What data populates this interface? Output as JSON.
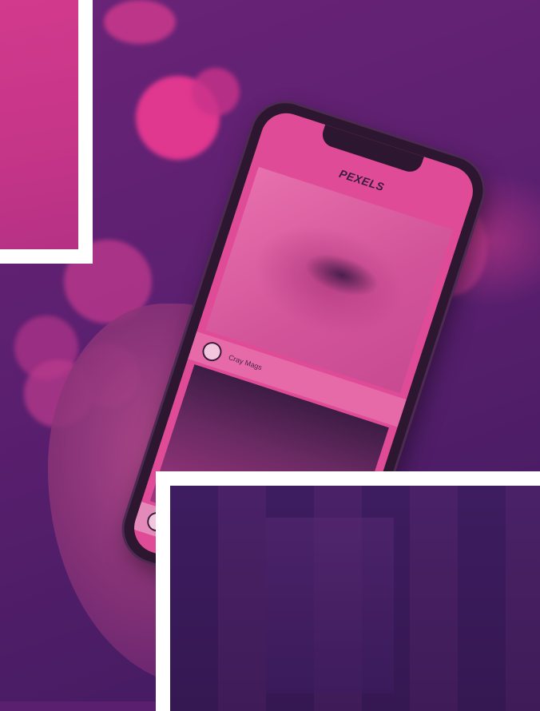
{
  "phone": {
    "app_title": "PEXELS",
    "author_1": "Cray Mags"
  },
  "colors": {
    "magenta": "#e04b98",
    "purple": "#5a1f6e",
    "frame": "#ffffff"
  }
}
